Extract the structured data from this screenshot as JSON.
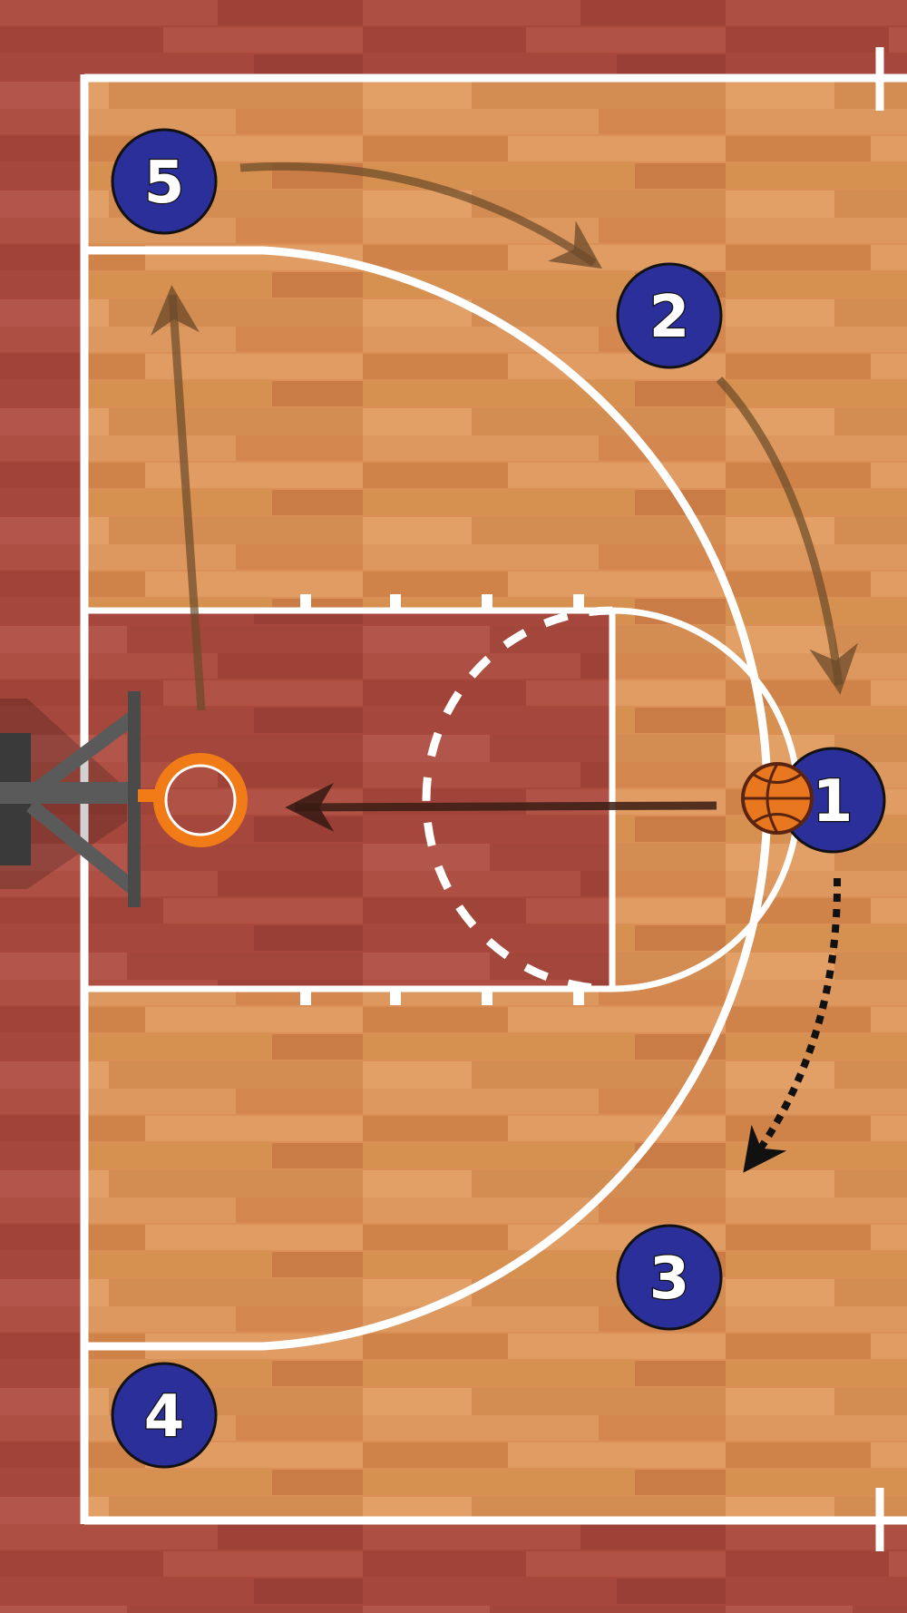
{
  "diagram": {
    "players": [
      {
        "label": "5"
      },
      {
        "label": "2"
      },
      {
        "label": "1"
      },
      {
        "label": "3"
      },
      {
        "label": "4"
      }
    ],
    "colors": {
      "floor": "#d98f55",
      "floor_dark": "#c97a42",
      "surround": "#a8483d",
      "paint": "#a34a3e",
      "lines": "#ffffff",
      "player_fill": "#2b2f99",
      "rim": "#f07b17",
      "ball": "#e8771f",
      "pass_arrow": "#3a1c14",
      "cut_arrow": "#6b4a2a",
      "dribble_arrow": "#111111",
      "backboard": "#555555"
    }
  }
}
